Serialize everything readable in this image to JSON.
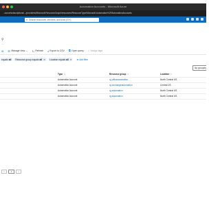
{
  "window": {
    "title": "Automation Accounts - Microsoft Azure",
    "traffic_lights": [
      "#ff5f57",
      "#febc2e",
      "#28c840"
    ],
    "url": "...ource/subscriptions/.../providers/Microsoft.ResourceGraph/resources/ResourceType/Microsoft.Automation%2FAutomationAccounts"
  },
  "azure": {
    "search_placeholder": "Search resources, services, and docs (G+/)",
    "accent": "#0f6cbd"
  },
  "toolbar": {
    "items": [
      {
        "icon": "gear-icon",
        "label": ""
      },
      {
        "icon": "list-icon",
        "label": "Manage view",
        "chevron": "⌄"
      },
      {
        "icon": "refresh-icon",
        "label": "Refresh"
      },
      {
        "icon": "export-icon",
        "label": "Export to CSV"
      },
      {
        "icon": "query-icon",
        "label": "Open query"
      },
      {
        "icon": "tag-icon",
        "label": "Assign tags"
      }
    ]
  },
  "filters": [
    {
      "name": "equals",
      "value": "all"
    },
    {
      "name": "Resource group equals",
      "value": "all"
    },
    {
      "name": "Location equals",
      "value": "all"
    }
  ],
  "add_filter_label": "Add filter",
  "grouping_label": "No grouping",
  "table": {
    "headers": [
      "Type",
      "Resource group",
      "Location"
    ],
    "rows": [
      {
        "type": "Automation Account",
        "rg": "rg-officeautomation",
        "loc": "North Central US"
      },
      {
        "type": "Automation Account",
        "rg": "rg-exchangeautomation",
        "loc": "Central US"
      },
      {
        "type": "Automation Account",
        "rg": "rg-automation",
        "loc": "North Central US"
      },
      {
        "type": "Automation Account",
        "rg": "rg-automation",
        "loc": "North Central US"
      }
    ]
  },
  "pagination": {
    "prev": "<",
    "page": "1",
    "next": ">"
  }
}
